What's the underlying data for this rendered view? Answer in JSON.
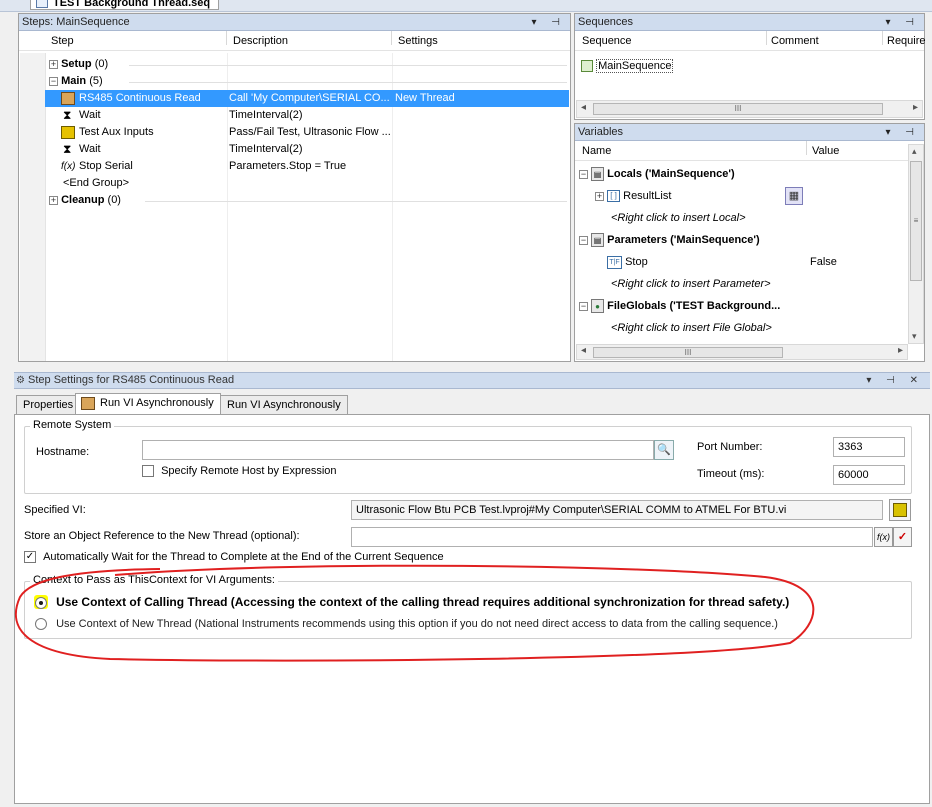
{
  "window": {
    "title": "TEST Background Thread.seq"
  },
  "steps_panel": {
    "title": "Steps: MainSequence",
    "columns": [
      "Step",
      "Description",
      "Settings"
    ],
    "groups": {
      "setup": {
        "label": "Setup",
        "count": "(0)"
      },
      "main": {
        "label": "Main",
        "count": "(5)"
      },
      "cleanup": {
        "label": "Cleanup",
        "count": "(0)"
      }
    },
    "rows": [
      {
        "step": "RS485 Continuous Read",
        "description": "Call 'My Computer\\SERIAL CO...",
        "settings": "New Thread",
        "icon": "vi-icon",
        "selected": true
      },
      {
        "step": "Wait",
        "description": "TimeInterval(2)",
        "settings": "",
        "icon": "hourglass-icon"
      },
      {
        "step": "Test Aux Inputs",
        "description": "Pass/Fail Test,  Ultrasonic Flow ...",
        "settings": "",
        "icon": "vi-icon"
      },
      {
        "step": "Wait",
        "description": "TimeInterval(2)",
        "settings": "",
        "icon": "hourglass-icon"
      },
      {
        "step": "Stop Serial",
        "description": "Parameters.Stop = True",
        "settings": "",
        "icon": "expression-icon",
        "icon_glyph": "f(x)"
      },
      {
        "step": "<End Group>",
        "description": "",
        "settings": "",
        "icon": ""
      }
    ]
  },
  "sequences_panel": {
    "title": "Sequences",
    "columns": [
      "Sequence",
      "Comment",
      "Require"
    ],
    "items": [
      "MainSequence"
    ],
    "scroll_grip": "III"
  },
  "variables_panel": {
    "title": "Variables",
    "columns": [
      "Name",
      "Value"
    ],
    "locals": {
      "label": "Locals ('MainSequence')",
      "result_list": "ResultList",
      "hint": "<Right click to insert Local>"
    },
    "parameters": {
      "label": "Parameters ('MainSequence')",
      "stop": "Stop",
      "stop_type": "T|F",
      "stop_value": "False",
      "hint": "<Right click to insert Parameter>"
    },
    "file_globals": {
      "label": "FileGlobals ('TEST Background...",
      "hint": "<Right click to insert File Global>"
    },
    "scroll_grip": "III"
  },
  "settings_panel": {
    "title": "Step Settings for RS485 Continuous Read",
    "tabs": [
      "Properties",
      "Run VI Asynchronously",
      "Run VI Asynchronously"
    ],
    "remote_system": {
      "legend": "Remote System",
      "hostname_label": "Hostname:",
      "hostname_value": "",
      "specify_by_expression": "Specify Remote Host by Expression",
      "port_label": "Port Number:",
      "port_value": "3363",
      "timeout_label": "Timeout (ms):",
      "timeout_value": "60000"
    },
    "specified_vi_label": "Specified VI:",
    "specified_vi_value": "Ultrasonic Flow Btu PCB Test.lvproj#My Computer\\SERIAL COMM to ATMEL For BTU.vi",
    "store_ref_label": "Store an Object Reference to the New Thread (optional):",
    "store_ref_value": "",
    "auto_wait_label": "Automatically Wait for the Thread to Complete at the End of the Current Sequence",
    "context_group": {
      "legend": "Context to Pass as ThisContext for VI Arguments:",
      "option_calling": "Use Context of Calling Thread (Accessing the context of the calling thread requires additional synchronization for thread safety.)",
      "option_new": "Use Context of New Thread (National Instruments recommends using this option if you do not need direct access to data from the calling sequence.)"
    }
  },
  "colors": {
    "selection": "#3399ff",
    "panel_header": "#cfdcee",
    "annotation": "#e02020",
    "highlight": "#ffff00"
  }
}
